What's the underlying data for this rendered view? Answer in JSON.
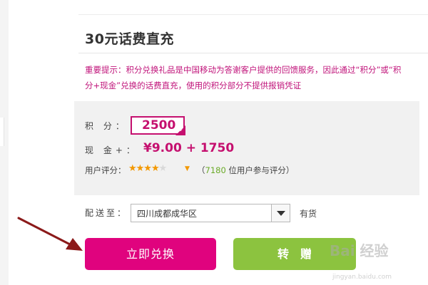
{
  "product": {
    "title": "30元话费直充"
  },
  "notice": {
    "line1": "重要提示：积分兑换礼品是中国移动为答谢客户提供的回馈服务，因此通过“积分”或“积",
    "line2": "分+现金”兑换的话费直充，使用的积分部分不提供报销凭证"
  },
  "pricing": {
    "points_label": "积 分：",
    "points_value": "2500",
    "cash_label": "现 金+：",
    "cash_value": "¥9.00 + 1750"
  },
  "rating": {
    "label": "用户评分：",
    "stars_full": "★★★★",
    "stars_partial": "★",
    "stars_value": 4.5,
    "open_paren": "（",
    "count": "7180",
    "count_suffix": " 位用户参与评分）"
  },
  "shipping": {
    "label": "配送至：",
    "region": "四川成都成华区",
    "stock_status": "有货"
  },
  "actions": {
    "redeem_label": "立即兑换",
    "gift_label": "转赠"
  },
  "watermark": {
    "text": "Bai 经验",
    "sub": "jingyan.baidu.com"
  },
  "colors": {
    "accent": "#e0037e",
    "price": "#c5106f",
    "gift": "#8cc33f",
    "star": "#f39800",
    "annotation_arrow": "#8b1a1a"
  },
  "icons": {
    "check": "check-corner-icon",
    "dropdown": "dropdown-arrow-icon",
    "caret": "rating-caret-icon",
    "annotation": "pointer-arrow-icon"
  }
}
